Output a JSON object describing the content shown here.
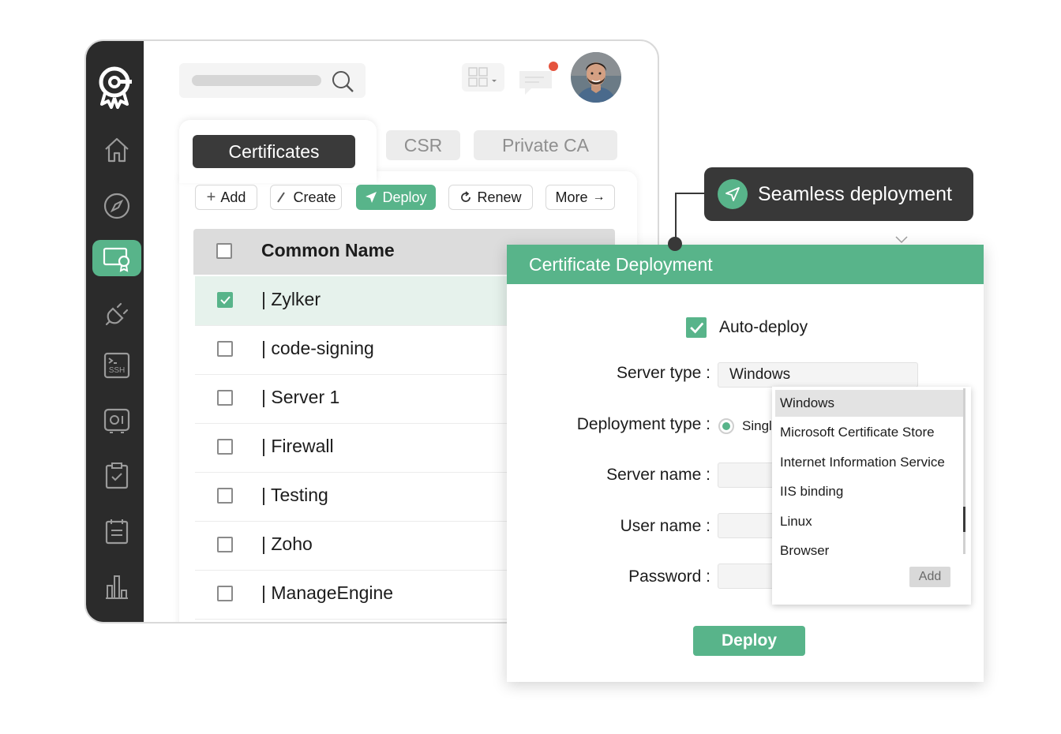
{
  "colors": {
    "accent": "#58b48a",
    "sidebar": "#2b2b2b",
    "dark": "#383838",
    "notification": "#e5533d"
  },
  "sidebar": {
    "logo_icon": "key-badge-logo-icon",
    "items": [
      {
        "icon": "home-icon",
        "active": false
      },
      {
        "icon": "compass-icon",
        "active": false
      },
      {
        "icon": "certificate-icon",
        "active": true
      },
      {
        "icon": "plug-icon",
        "active": false
      },
      {
        "icon": "ssh-terminal-icon",
        "label": "SSH",
        "active": false
      },
      {
        "icon": "device-icon",
        "active": false
      },
      {
        "icon": "clipboard-check-icon",
        "active": false
      },
      {
        "icon": "calendar-list-icon",
        "active": false
      },
      {
        "icon": "bar-chart-icon",
        "active": false
      }
    ]
  },
  "header": {
    "search_icon": "search-icon",
    "grid_icon": "grid-icon",
    "chat_icon": "chat-icon",
    "avatar": "user-avatar"
  },
  "tabs": [
    {
      "label": "Certificates",
      "active": true
    },
    {
      "label": "CSR",
      "active": false
    },
    {
      "label": "Private CA",
      "active": false
    }
  ],
  "toolbar": {
    "add": "Add",
    "create": "Create",
    "deploy": "Deploy",
    "renew": "Renew",
    "more": "More"
  },
  "table": {
    "header": "Common Name",
    "rows": [
      {
        "name": "| Zylker",
        "checked": true
      },
      {
        "name": "| code-signing",
        "checked": false
      },
      {
        "name": "| Server 1",
        "checked": false
      },
      {
        "name": "| Firewall",
        "checked": false
      },
      {
        "name": "| Testing",
        "checked": false
      },
      {
        "name": "| Zoho",
        "checked": false
      },
      {
        "name": "| ManageEngine",
        "checked": false
      }
    ]
  },
  "tooltip": {
    "text": "Seamless deployment",
    "icon": "send-icon"
  },
  "dialog": {
    "title": "Certificate Deployment",
    "auto_deploy": "Auto-deploy",
    "server_type_label": "Server type :",
    "server_type_value": "Windows",
    "deployment_type_label": "Deployment type :",
    "deployment_type_value": "Singl",
    "server_name_label": "Server name :",
    "user_name_label": "User name :",
    "password_label": "Password :",
    "dropdown_options": [
      "Windows",
      "Microsoft Certificate Store",
      "Internet Information Service",
      "IIS binding",
      "Linux",
      "Browser"
    ],
    "dropdown_add": "Add",
    "deploy_button": "Deploy"
  }
}
